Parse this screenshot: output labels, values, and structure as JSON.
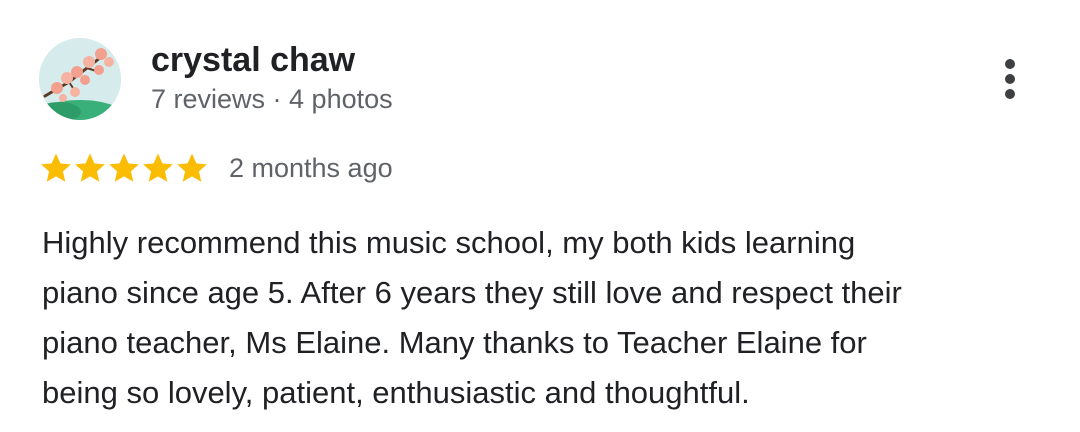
{
  "reviewer": {
    "name": "crystal chaw",
    "meta": "7 reviews · 4 photos",
    "avatar_icon": "cherry-blossom-avatar"
  },
  "menu": {
    "icon": "more-vert-icon"
  },
  "rating": {
    "stars": 5,
    "max_stars": 5,
    "star_color": "#fbbc04",
    "time": "2 months ago"
  },
  "review": {
    "lines": [
      "Highly recommend this music school, my both kids learning",
      "piano since age 5. After 6 years they still love and respect their",
      "piano teacher, Ms Elaine. Many thanks to Teacher Elaine for",
      "being so lovely, patient, enthusiastic and thoughtful."
    ]
  }
}
